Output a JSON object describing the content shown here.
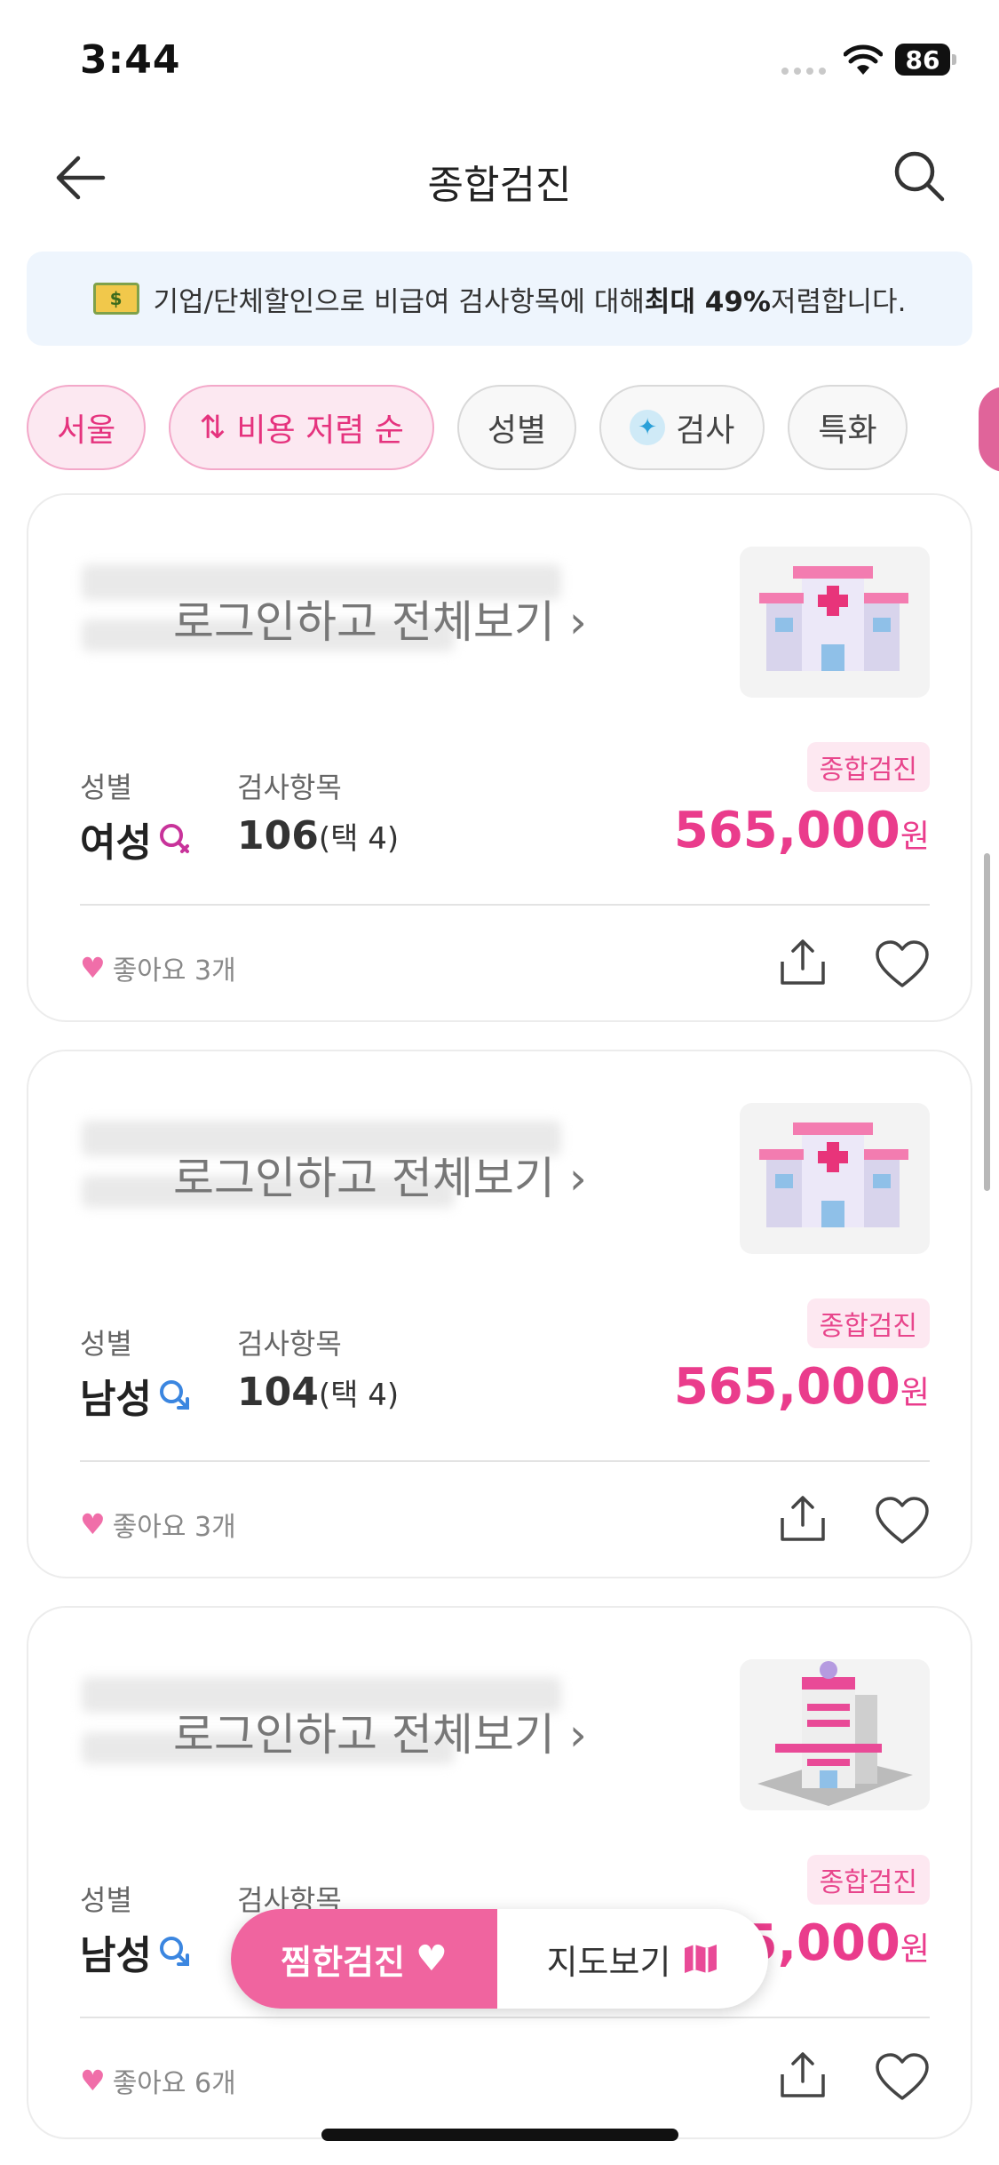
{
  "status": {
    "time": "3:44",
    "battery": "86"
  },
  "header": {
    "title": "종합검진"
  },
  "banner": {
    "prefix": "기업/단체할인으로 비급여 검사항목에 대해 ",
    "highlight": "최대 49%",
    "suffix": " 저렴합니다.",
    "icon_text": "$"
  },
  "chips": [
    {
      "label": "서울",
      "active": true
    },
    {
      "label": "비용 저렴 순",
      "icon": "sort-icon",
      "active": true
    },
    {
      "label": "성별",
      "active": false
    },
    {
      "label": "검사",
      "icon": "person-icon",
      "active": false
    },
    {
      "label": "특화",
      "active": false
    }
  ],
  "cards": [
    {
      "login_text": "로그인하고 전체보기",
      "thumb": "hospital-building-icon",
      "tag": "종합검진",
      "gender_label": "성별",
      "gender_value": "여성",
      "gender_icon": "female-search-icon",
      "items_label": "검사항목",
      "items_count": "106",
      "items_choice": "(택 4)",
      "price": "565,000",
      "currency": "원",
      "likes": "좋아요 3개"
    },
    {
      "login_text": "로그인하고 전체보기",
      "thumb": "hospital-building-icon",
      "tag": "종합검진",
      "gender_label": "성별",
      "gender_value": "남성",
      "gender_icon": "male-search-icon",
      "items_label": "검사항목",
      "items_count": "104",
      "items_choice": "(택 4)",
      "price": "565,000",
      "currency": "원",
      "likes": "좋아요 3개"
    },
    {
      "login_text": "로그인하고 전체보기",
      "thumb": "hospital-tower-icon",
      "tag": "종합검진",
      "gender_label": "성별",
      "gender_value": "남성",
      "gender_icon": "male-search-icon",
      "items_label": "검사항목",
      "price_partial": "5,000",
      "currency": "원",
      "likes": "좋아요 6개"
    }
  ],
  "floating": {
    "favorites": "찜한검진",
    "map": "지도보기"
  },
  "colors": {
    "accent": "#ea3c8c",
    "accent_light": "#fde8f1",
    "male": "#3b86e0",
    "female": "#c8339a"
  }
}
